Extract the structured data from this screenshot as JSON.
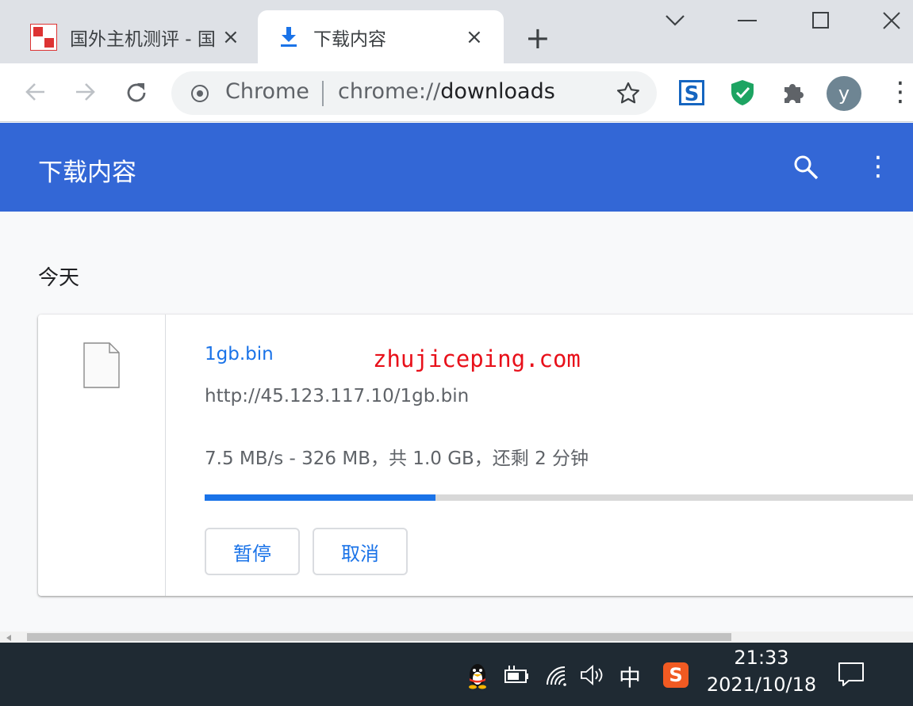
{
  "tabs": [
    {
      "title": "国外主机测评 - 国",
      "close": "×",
      "icon": "site-favicon"
    },
    {
      "title": "下载内容",
      "close": "×",
      "icon": "download-icon"
    }
  ],
  "new_tab": "+",
  "window_controls": {
    "minimize": "−",
    "maximize": "☐",
    "close": "✕",
    "collapse": "⌄"
  },
  "toolbar": {
    "back": "←",
    "forward": "→",
    "reload": "↻",
    "omnibox_label": "Chrome",
    "url_prefix": "chrome://",
    "url_path": "downloads",
    "bookmark": "☆",
    "profile_initial": "y",
    "menu": "⋮"
  },
  "header": {
    "title": "下载内容",
    "menu": "⋮"
  },
  "section": {
    "label": "今天"
  },
  "download": {
    "filename": "1gb.bin",
    "watermark": "zhujiceping.com",
    "url": "http://45.123.117.10/1gb.bin",
    "status": "7.5 MB/s - 326 MB，共 1.0 GB，还剩 2 分钟",
    "progress_percent": 32.6,
    "pause_label": "暂停",
    "cancel_label": "取消"
  },
  "taskbar": {
    "ime": "中",
    "sogou": "S",
    "time": "21:33",
    "date": "2021/10/18"
  },
  "colors": {
    "accent": "#3367d6",
    "link": "#1a73e8",
    "watermark": "#e8101a",
    "shield": "#1da462",
    "taskbar": "#1f2a33"
  }
}
